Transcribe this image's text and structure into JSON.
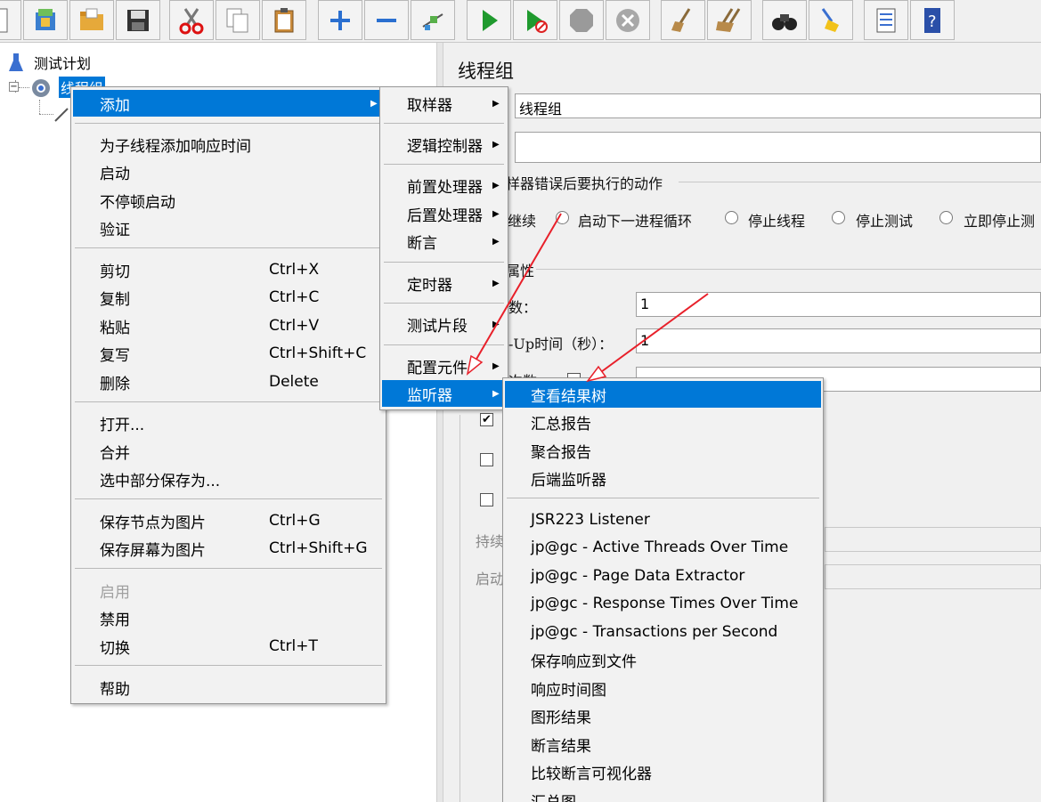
{
  "tree": {
    "root_label": "测试计划",
    "child_label": "线程组"
  },
  "right_panel": {
    "title": "线程组",
    "name_value": "线程组",
    "comment_value": "",
    "error_action_label": "样器错误后要执行的动作",
    "error_options": [
      "继续",
      "启动下一进程循环",
      "停止线程",
      "停止测试",
      "立即停止测"
    ],
    "props_label": "属性",
    "threads_label": "数：",
    "threads_value": "1",
    "rampup_label": "-Up时间（秒）：",
    "rampup_value": "1",
    "loop_label": "次数",
    "duration_label": "持续",
    "startup_label": "启动"
  },
  "main_menu": {
    "items": [
      {
        "label": "添加",
        "shortcut": "",
        "highlight": true,
        "submenu": true
      },
      {
        "label": "为子线程添加响应时间",
        "shortcut": ""
      },
      {
        "label": "启动",
        "shortcut": ""
      },
      {
        "label": "不停顿启动",
        "shortcut": ""
      },
      {
        "label": "验证",
        "shortcut": ""
      },
      {
        "label": "剪切",
        "shortcut": "Ctrl+X"
      },
      {
        "label": "复制",
        "shortcut": "Ctrl+C"
      },
      {
        "label": "粘贴",
        "shortcut": "Ctrl+V"
      },
      {
        "label": "复写",
        "shortcut": "Ctrl+Shift+C"
      },
      {
        "label": "删除",
        "shortcut": "Delete"
      },
      {
        "label": "打开...",
        "shortcut": ""
      },
      {
        "label": "合并",
        "shortcut": ""
      },
      {
        "label": "选中部分保存为...",
        "shortcut": ""
      },
      {
        "label": "保存节点为图片",
        "shortcut": "Ctrl+G"
      },
      {
        "label": "保存屏幕为图片",
        "shortcut": "Ctrl+Shift+G"
      },
      {
        "label": "启用",
        "shortcut": "",
        "disabled": true
      },
      {
        "label": "禁用",
        "shortcut": ""
      },
      {
        "label": "切换",
        "shortcut": "Ctrl+T"
      },
      {
        "label": "帮助",
        "shortcut": ""
      }
    ]
  },
  "add_menu": {
    "items": [
      "取样器",
      "逻辑控制器",
      "前置处理器",
      "后置处理器",
      "断言",
      "定时器",
      "测试片段",
      "配置元件",
      "监听器"
    ]
  },
  "listener_menu": {
    "items": [
      "查看结果树",
      "汇总报告",
      "聚合报告",
      "后端监听器",
      "JSR223 Listener",
      "jp@gc - Active Threads Over Time",
      "jp@gc - Page Data Extractor",
      "jp@gc - Response Times Over Time",
      "jp@gc - Transactions per Second",
      "保存响应到文件",
      "响应时间图",
      "图形结果",
      "断言结果",
      "比较断言可视化器",
      "汇总图"
    ]
  },
  "colors": {
    "highlight": "#0078d7",
    "annotation_arrow": "#e8202a"
  }
}
